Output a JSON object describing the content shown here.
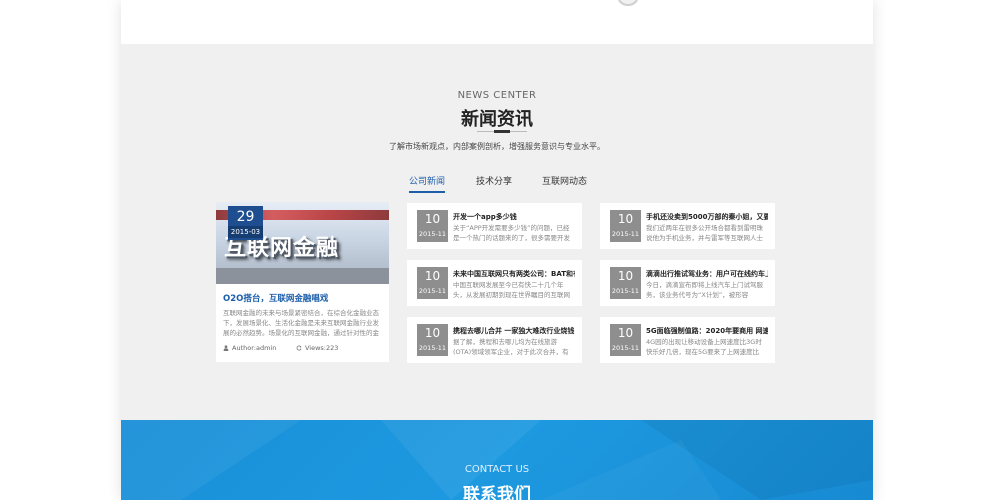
{
  "news": {
    "en_title": "NEWS CENTER",
    "cn_title": "新闻资讯",
    "subtitle": "了解市场新观点，内部案例剖析，增强服务意识与专业水平。",
    "tabs": [
      {
        "label": "公司新闻",
        "active": true
      },
      {
        "label": "技术分享",
        "active": false
      },
      {
        "label": "互联网动态",
        "active": false
      }
    ],
    "featured": {
      "image_text": "互联网金融",
      "day": "29",
      "month": "2015-03",
      "title": "O2O搭台，互联网金融唱戏",
      "desc": "互联网金融的未来与场景紧密结合，在综合化金融业态下，发展场景化、生活化金融是未来互联网金融行业发展的必然趋势。场景化的互联网金融，通过针对性的金融产品，",
      "author": "Author:admin",
      "views": "Views:223"
    },
    "cards": [
      {
        "day": "10",
        "month": "2015-11",
        "title": "开发一个app多少钱",
        "excerpt": "关于“APP开发需要多少钱”的问题，已经是一个热门的话题来的了，很多需要开发"
      },
      {
        "day": "10",
        "month": "2015-11",
        "title": "手机还没卖到5000万部的秦小姐，又要...",
        "excerpt": "我们近两年在很多公开场合都看到雷明珠说他为手机业务，并与雷军等互联网人士"
      },
      {
        "day": "10",
        "month": "2015-11",
        "title": "未来中国互联网只有两类公司：BAT和有...",
        "excerpt": "中国互联网发展至今已有快二十几个年头，从发展初期到现在世界瞩目的互联网大"
      },
      {
        "day": "10",
        "month": "2015-11",
        "title": "滴滴出行推试驾业务：用户可在线约车上...",
        "excerpt": "今日，滴滴宣布即将上线汽车上门试驾服务，该业务代号为“X计划”，被形容"
      },
      {
        "day": "10",
        "month": "2015-11",
        "title": "携程去哪儿合并 一家独大难改行业烧钱...",
        "excerpt": "据了解，携程和去哪儿均为在线旅游(OTA)领域领军企业，对于此次合并，有分"
      },
      {
        "day": "10",
        "month": "2015-11",
        "title": "5G面临强制值路：2020年要商用 网速为...",
        "excerpt": "4G园的出现让移动设备上网速度比3G时快乐好几倍，现在5G要来了上网速度比4G"
      }
    ]
  },
  "contact": {
    "en_title": "CONTACT US",
    "cn_title": "联系我们"
  },
  "colors": {
    "accent": "#1d5eaa",
    "date_badge": "#8e8e8e",
    "contact_bg": "#1d99e0",
    "section_bg": "#f0f0f0"
  },
  "icons": {
    "author": "user-icon",
    "views": "refresh-icon"
  }
}
